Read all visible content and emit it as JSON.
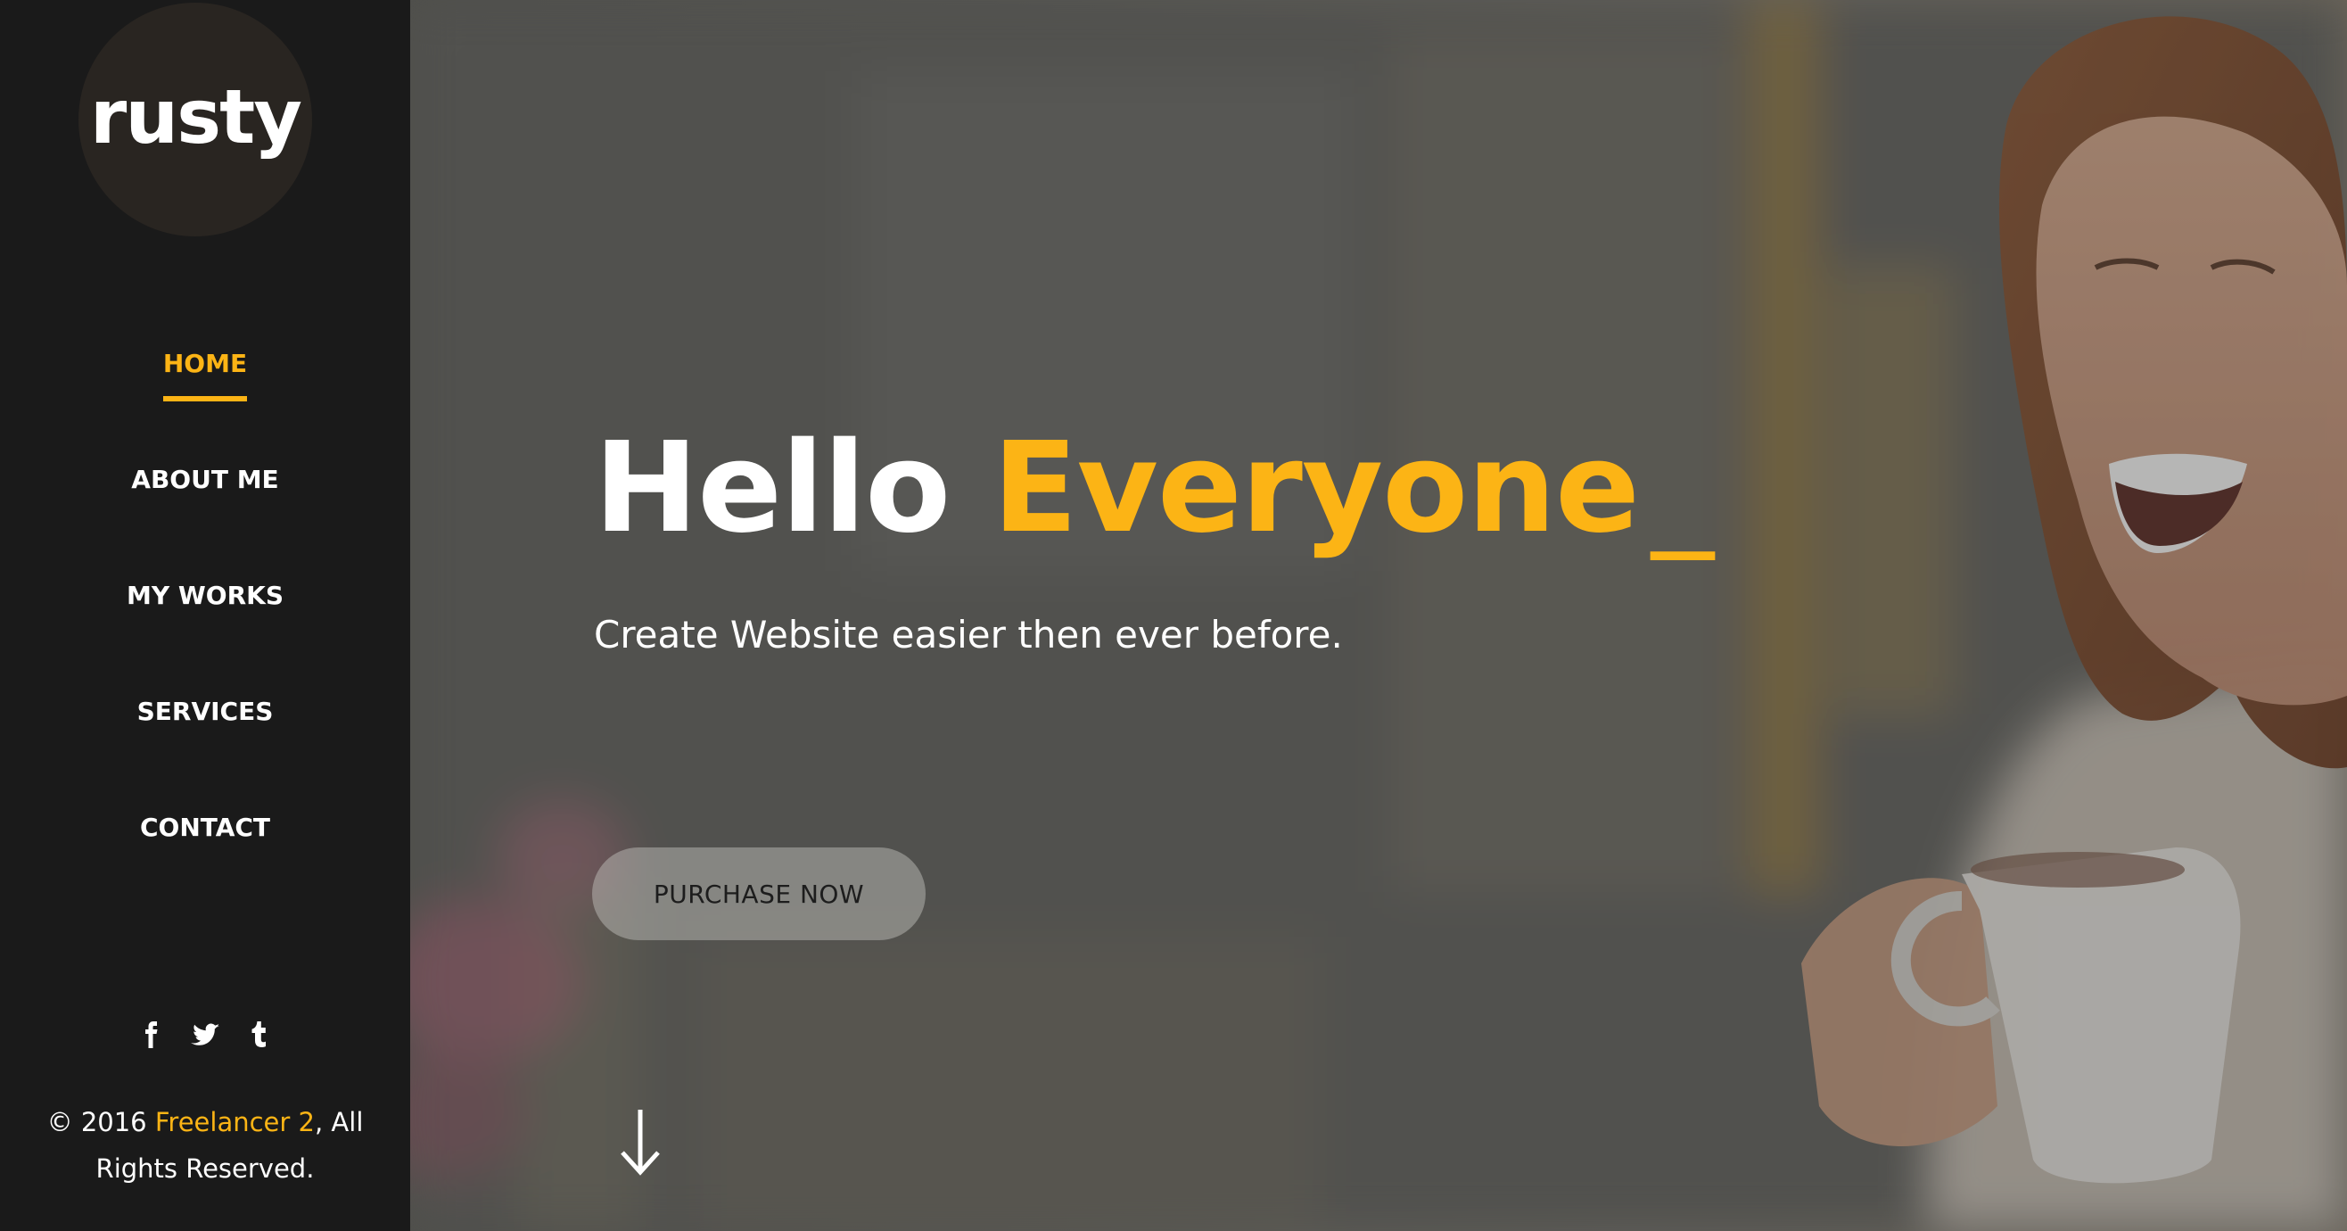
{
  "colors": {
    "accent": "#fcb415",
    "sidebar_bg": "#1a1a1a",
    "text": "#ffffff"
  },
  "sidebar": {
    "logo_text": "rusty",
    "nav": [
      {
        "label": "HOME",
        "active": true
      },
      {
        "label": "ABOUT ME",
        "active": false
      },
      {
        "label": "MY WORKS",
        "active": false
      },
      {
        "label": "SERVICES",
        "active": false
      },
      {
        "label": "CONTACT",
        "active": false
      }
    ],
    "social": [
      {
        "icon": "facebook-icon"
      },
      {
        "icon": "twitter-icon"
      },
      {
        "icon": "tumblr-icon"
      }
    ],
    "copyright": {
      "prefix": "© 2016 ",
      "brand": "Freelancer 2",
      "suffix": ", All Rights Reserved."
    }
  },
  "hero": {
    "title_plain": "Hello ",
    "title_highlight": "Everyone",
    "title_cursor": "_",
    "subtitle": "Create Website easier then ever before.",
    "cta_label": "PURCHASE NOW",
    "scroll_icon": "arrow-down-icon"
  }
}
